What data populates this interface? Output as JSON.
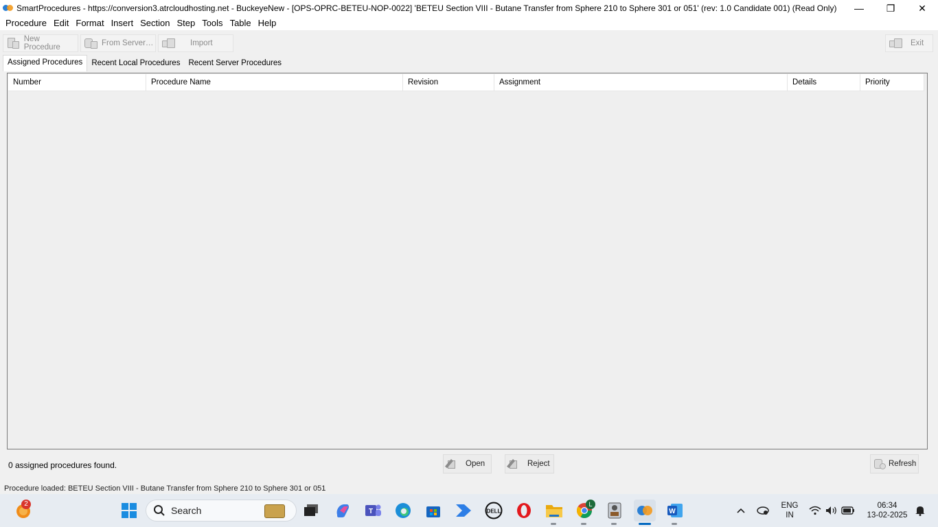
{
  "window": {
    "title": "SmartProcedures - https://conversion3.atrcloudhosting.net - BuckeyeNew - [OPS-OPRC-BETEU-NOP-0022] 'BETEU Section VIII - Butane Transfer from Sphere 210 to Sphere 301 or 051' (rev: 1.0 Candidate 001) (Read Only)",
    "minimize": "—",
    "restore": "❐",
    "close": "✕"
  },
  "menu": [
    "Procedure",
    "Edit",
    "Format",
    "Insert",
    "Section",
    "Step",
    "Tools",
    "Table",
    "Help"
  ],
  "toolbar": {
    "new_procedure": "New Procedure",
    "from_server": "From Server…",
    "import": "Import",
    "exit": "Exit"
  },
  "tabs": [
    "Assigned Procedures",
    "Recent Local Procedures",
    "Recent Server Procedures"
  ],
  "table": {
    "columns": [
      "Number",
      "Procedure Name",
      "Revision",
      "Assignment",
      "Details",
      "Priority"
    ],
    "rows": []
  },
  "footer": {
    "count_text": "0 assigned procedures found.",
    "open": "Open",
    "reject": "Reject",
    "refresh": "Refresh"
  },
  "statusbar": {
    "text": "Procedure loaded: BETEU Section VIII - Butane Transfer from Sphere 210 to Sphere 301 or 051"
  },
  "taskbar": {
    "search_placeholder": "Search",
    "notification_badge": "2",
    "chrome_badge": "L",
    "language": "ENG",
    "region": "IN",
    "time": "06:34",
    "date": "13-02-2025",
    "icons": [
      "weather-icon",
      "windows-start-icon",
      "search-icon",
      "task-view-icon",
      "copilot-icon",
      "teams-icon",
      "edge-icon",
      "store-icon",
      "power-automate-icon",
      "dell-icon",
      "opera-icon",
      "file-explorer-icon",
      "chrome-icon",
      "remote-app-icon",
      "smartprocedures-icon",
      "word-icon"
    ]
  },
  "colors": {
    "accent": "#0078d4",
    "taskbar": "#e7ecf2",
    "window_bg": "#f0f0f0"
  }
}
